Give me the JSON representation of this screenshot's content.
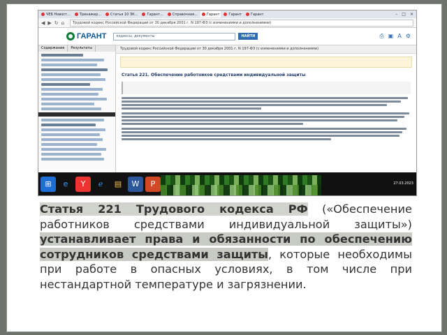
{
  "browser": {
    "tabs": [
      {
        "label": "ЧЕБ Новост..."
      },
      {
        "label": "Тренажер..."
      },
      {
        "label": "Статья 10 ЗК..."
      },
      {
        "label": "Гарант..."
      },
      {
        "label": "Справочная..."
      },
      {
        "label": "Гарант"
      },
      {
        "label": "Гарант"
      },
      {
        "label": "Гарант"
      }
    ],
    "url": "Трудовой кодекс Российской Федерации от 30 декабря 2001 г. N 197-ФЗ (с изменениями и дополнениями)",
    "nav_icons": [
      "back-icon",
      "forward-icon",
      "refresh-icon",
      "home-icon"
    ],
    "window_controls": [
      "–",
      "□",
      "×"
    ]
  },
  "garant": {
    "logo_text": "ГАРАНТ",
    "search_placeholder": "кодексы, документы",
    "find_label": "НАЙТИ",
    "toolbar_icons": [
      "print-icon",
      "save-icon",
      "font-icon",
      "settings-icon"
    ],
    "sidebar_tabs": [
      "Содержание",
      "Результаты"
    ],
    "doc_header": "Трудовой кодекс Российской Федерации от 30 декабря 2001 г. N 197-ФЗ (с изменениями и дополнениями)",
    "article_title": "Статья 221. Обеспечение работников средствами индивидуальной защиты"
  },
  "taskbar": {
    "icons": [
      "windows-start-icon",
      "ie-icon",
      "yandex-icon",
      "edge-icon",
      "explorer-icon",
      "word-icon",
      "powerpoint-icon",
      "excel-icon"
    ],
    "date": "27.03.2023"
  },
  "caption": {
    "part1": "Статья 221 Трудового кодекса РФ",
    "part2": " («Обеспечение работников средствами индивидуальной защиты») ",
    "part3": "устанавливает права и обязанности по обеспечению сотрудников средствами защиты",
    "part4": ", которые необходимы при работе в опасных условиях, в том числе при нестандартной температуре и загрязнении."
  }
}
